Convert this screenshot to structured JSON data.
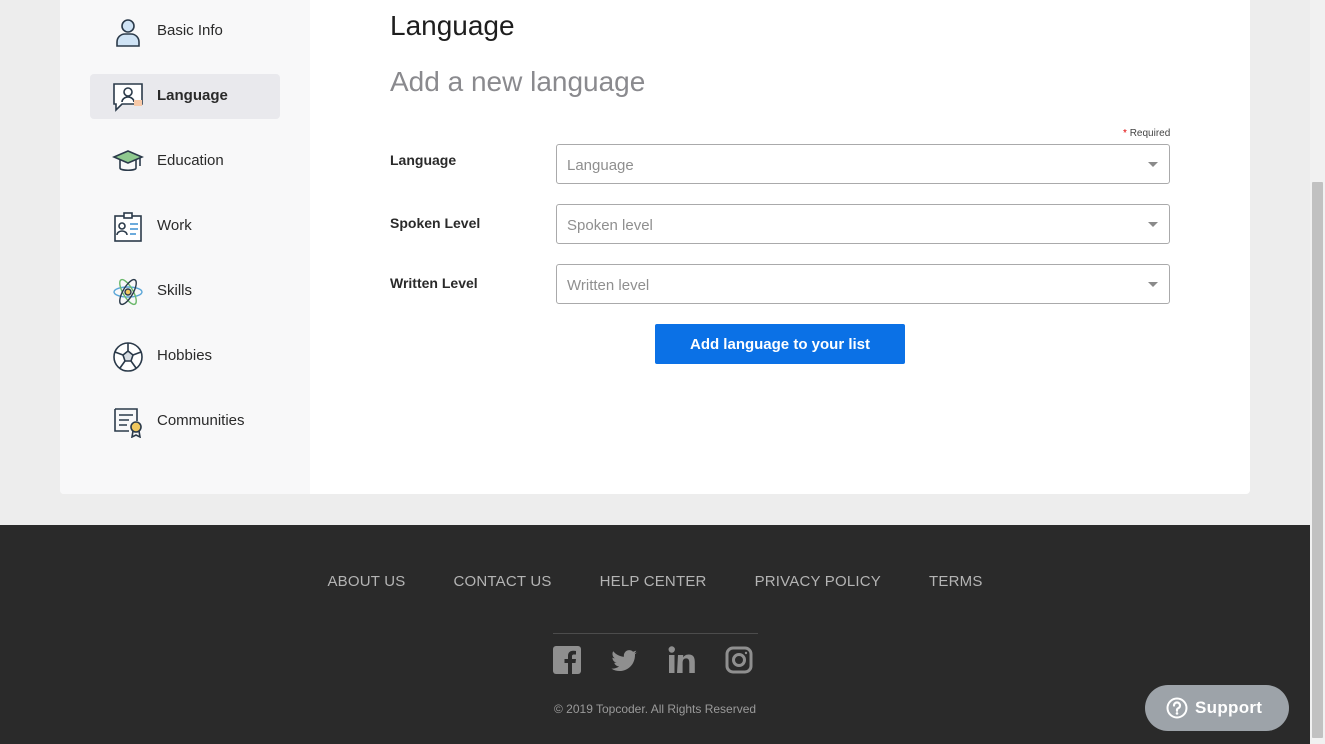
{
  "sidebar": {
    "items": [
      {
        "label": "Basic Info",
        "icon": "person-icon",
        "active": false
      },
      {
        "label": "Language",
        "icon": "speech-bubble-person-icon",
        "active": true
      },
      {
        "label": "Education",
        "icon": "graduation-cap-icon",
        "active": false
      },
      {
        "label": "Work",
        "icon": "id-card-icon",
        "active": false
      },
      {
        "label": "Skills",
        "icon": "atom-icon",
        "active": false
      },
      {
        "label": "Hobbies",
        "icon": "soccer-ball-icon",
        "active": false
      },
      {
        "label": "Communities",
        "icon": "certificate-icon",
        "active": false
      }
    ]
  },
  "main": {
    "title": "Language",
    "subtitle": "Add a new language",
    "required_star": "*",
    "required_text": "Required",
    "fields": [
      {
        "label": "Language",
        "placeholder": "Language"
      },
      {
        "label": "Spoken Level",
        "placeholder": "Spoken level"
      },
      {
        "label": "Written Level",
        "placeholder": "Written level"
      }
    ],
    "submit_label": "Add language to your list"
  },
  "footer": {
    "links": [
      "ABOUT US",
      "CONTACT US",
      "HELP CENTER",
      "PRIVACY POLICY",
      "TERMS"
    ],
    "social": [
      "facebook-icon",
      "twitter-icon",
      "linkedin-icon",
      "instagram-icon"
    ],
    "copyright": "© 2019 Topcoder. All Rights Reserved"
  },
  "support": {
    "label": "Support",
    "icon": "help-circle-icon"
  },
  "colors": {
    "accent": "#0b71e6",
    "footer_bg": "#2a2a2a",
    "page_bg": "#ededed",
    "required": "#e00000"
  }
}
